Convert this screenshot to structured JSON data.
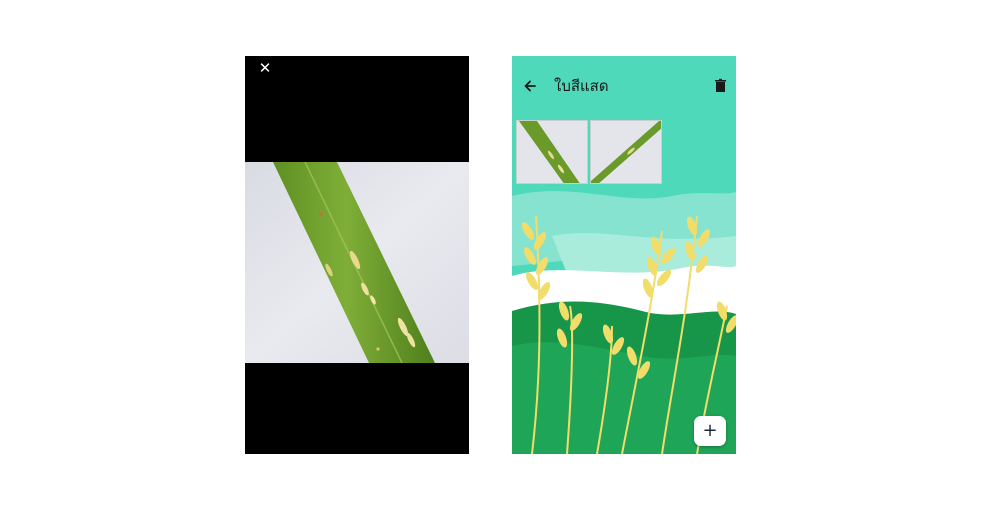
{
  "viewer": {
    "close_icon": "close-icon",
    "close_glyph": "✕"
  },
  "album": {
    "back_icon": "arrow-back-icon",
    "title": "ใบสีแสด",
    "delete_icon": "trash-icon",
    "thumbnail_count": 2,
    "add_icon": "plus-icon",
    "add_glyph": "+"
  },
  "colors": {
    "accent": "#4fd9bb",
    "leaf": "#6a9a2a",
    "wheat": "#f2dc6a",
    "field": "#17964a"
  }
}
